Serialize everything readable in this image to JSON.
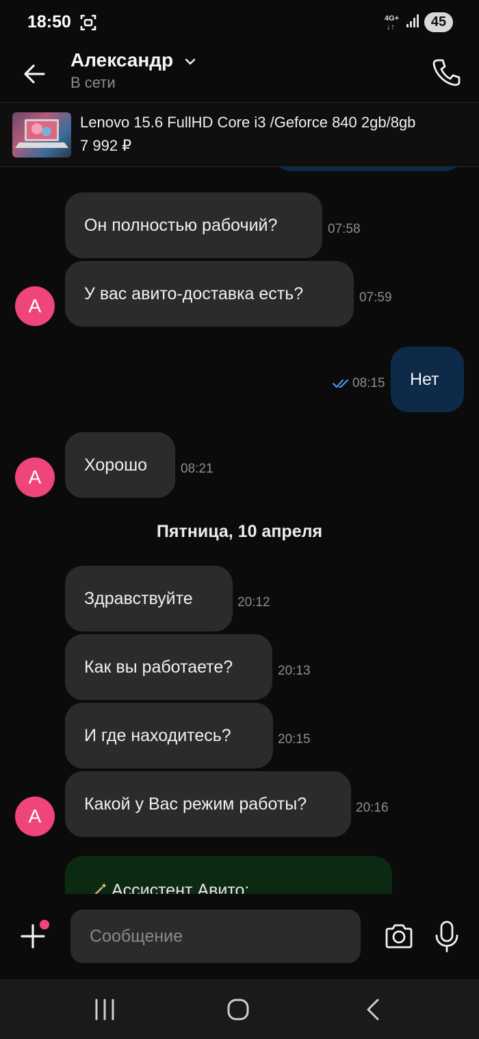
{
  "status_bar": {
    "time": "18:50",
    "network": "4G+",
    "battery": "45"
  },
  "header": {
    "contact_name": "Александр",
    "contact_status": "В сети"
  },
  "listing": {
    "title": "Lenovo 15.6 FullHD Core i3 /Geforce 840 2gb/8gb",
    "price": "7 992 ₽"
  },
  "messages": [
    {
      "text": "Он полностью рабочий?",
      "time": "07:58",
      "direction": "in"
    },
    {
      "text": "У вас авито-доставка есть?",
      "time": "07:59",
      "direction": "in",
      "avatar": "А"
    },
    {
      "text": "Нет",
      "time": "08:15",
      "direction": "out",
      "status": "read"
    },
    {
      "text": "Хорошо",
      "time": "08:21",
      "direction": "in",
      "avatar": "А"
    },
    {
      "text": "Здравствуйте",
      "time": "20:12",
      "direction": "in"
    },
    {
      "text": "Как вы работаете?",
      "time": "20:13",
      "direction": "in"
    },
    {
      "text": "И где находитесь?",
      "time": "20:15",
      "direction": "in"
    },
    {
      "text": "Какой у Вас режим работы?",
      "time": "20:16",
      "direction": "in",
      "avatar": "А"
    }
  ],
  "date_separator": "Пятница, 10 апреля",
  "assistant": {
    "label": "Ассистент Авито:"
  },
  "composer": {
    "placeholder": "Сообщение"
  },
  "colors": {
    "background": "#0b0b0b",
    "incoming_bubble": "#2b2b2b",
    "outgoing_bubble": "#0e2a49",
    "assistant_bubble": "#0c2a12",
    "avatar": "#f0457a",
    "read_ticks": "#4da3ff"
  },
  "icons": {
    "back": "arrow-left-icon",
    "call": "phone-icon",
    "add": "plus-icon",
    "camera": "camera-icon",
    "mic": "microphone-icon"
  }
}
